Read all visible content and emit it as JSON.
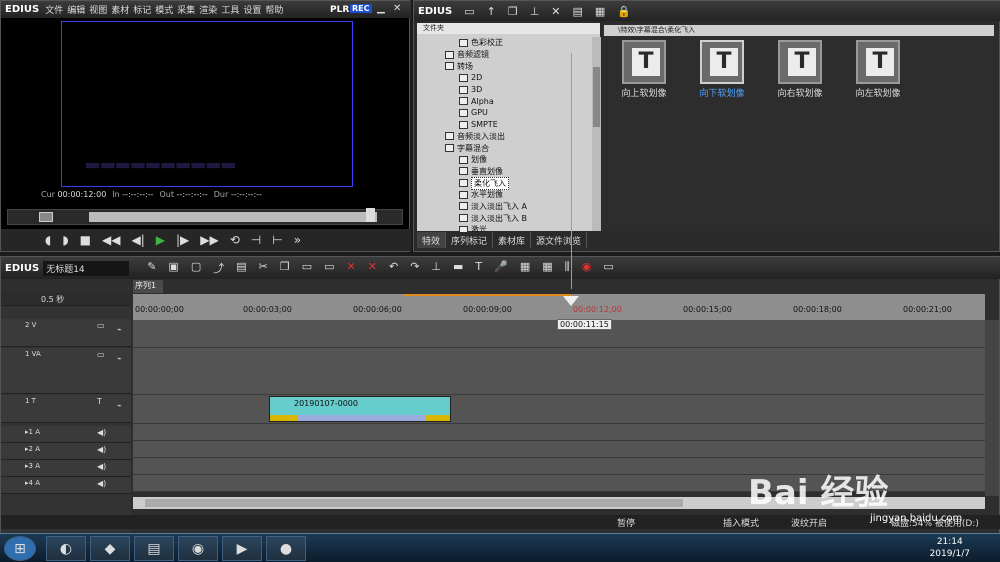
{
  "player": {
    "app_name": "EDIUS",
    "menu": [
      "文件",
      "编辑",
      "视图",
      "素材",
      "标记",
      "模式",
      "采集",
      "渲染",
      "工具",
      "设置",
      "帮助"
    ],
    "plr": "PLR",
    "rec": "REC",
    "cur_label": "Cur",
    "cur_value": "00:00:12:00",
    "in_label": "In",
    "in_value": "--:--:--:--",
    "out_label": "Out",
    "out_value": "--:--:--:--",
    "dur_label": "Dur",
    "dur_value": "--:--:--:--"
  },
  "bin": {
    "app_name": "EDIUS",
    "folder_header": "文件夹",
    "path": "\\特效\\字幕混合\\柔化飞入",
    "tree": [
      {
        "label": "色彩校正",
        "indent": 3
      },
      {
        "label": "音频滤镜",
        "indent": 2
      },
      {
        "label": "转场",
        "indent": 2
      },
      {
        "label": "2D",
        "indent": 3
      },
      {
        "label": "3D",
        "indent": 3
      },
      {
        "label": "Alpha",
        "indent": 3
      },
      {
        "label": "GPU",
        "indent": 3
      },
      {
        "label": "SMPTE",
        "indent": 3
      },
      {
        "label": "音频淡入淡出",
        "indent": 2
      },
      {
        "label": "字幕混合",
        "indent": 2
      },
      {
        "label": "划像",
        "indent": 3
      },
      {
        "label": "垂直划像",
        "indent": 3
      },
      {
        "label": "柔化飞入",
        "indent": 3
      },
      {
        "label": "水平划像",
        "indent": 3
      },
      {
        "label": "淡入淡出飞入 A",
        "indent": 3
      },
      {
        "label": "淡入淡出飞入 B",
        "indent": 3
      },
      {
        "label": "激光",
        "indent": 3
      }
    ],
    "effects": [
      {
        "label": "向上软划像",
        "arrow": "▲"
      },
      {
        "label": "向下软划像",
        "arrow": "▼"
      },
      {
        "label": "向右软划像",
        "arrow": "▶"
      },
      {
        "label": "向左软划像",
        "arrow": "◀"
      }
    ],
    "tabs": [
      "特效",
      "序列标记",
      "素材库",
      "源文件浏览"
    ]
  },
  "timeline": {
    "app_name": "EDIUS",
    "project": "无标题14",
    "seq_tab": "序列1",
    "zoom": "0.5 秒",
    "ruler": [
      "00:00:00;00",
      "00:00:03;00",
      "00:00:06;00",
      "00:00:09;00",
      "00:00:12;00",
      "00:00:15;00",
      "00:00:18;00",
      "00:00:21;00"
    ],
    "tracks": [
      {
        "name": "2 V"
      },
      {
        "name": "1 VA"
      },
      {
        "name": "1 T"
      },
      {
        "name": "▸1 A"
      },
      {
        "name": "▸2 A"
      },
      {
        "name": "▸3 A"
      },
      {
        "name": "▸4 A"
      }
    ],
    "clip_name": "20190107-0000",
    "playhead_tip": "00:00:11:15",
    "status_pause": "暂停",
    "status_insert": "插入模式",
    "status_ripple": "波纹开启",
    "status_disk": "磁盘:54% 被使用(D:)"
  },
  "taskbar": {
    "time": "21:14",
    "date": "2019/1/7"
  },
  "watermark": {
    "main": "Bai 经验",
    "sub": "jingyan.baidu.com"
  }
}
